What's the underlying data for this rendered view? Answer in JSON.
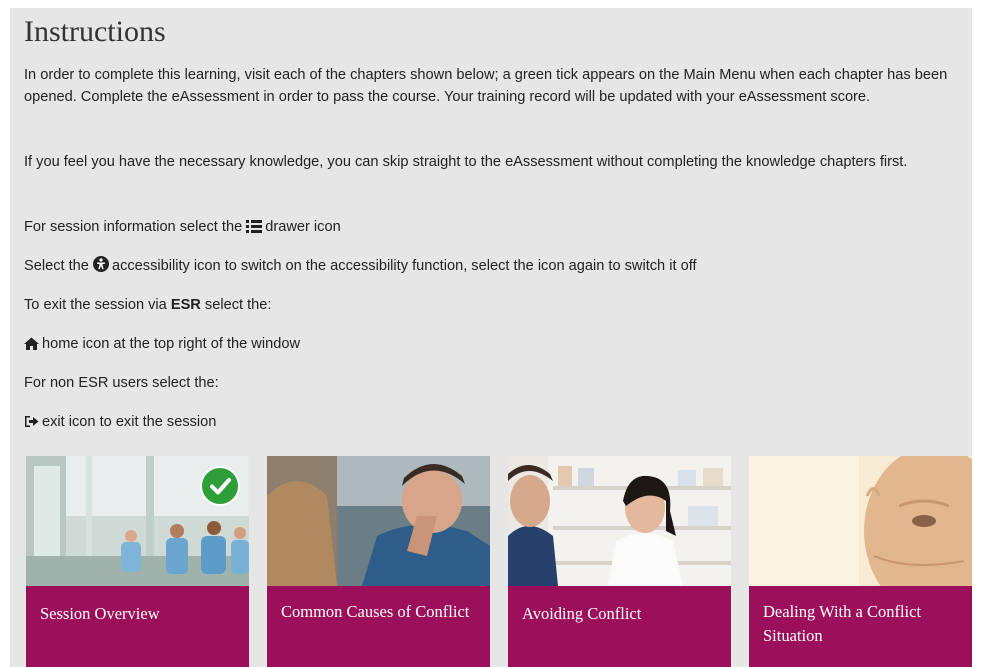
{
  "title": "Instructions",
  "paragraphs": {
    "p1": "In order to complete this learning, visit each of the chapters shown below; a green tick appears on the Main Menu when each chapter has been opened. Complete the eAssessment in order to pass the course. Your training record will be updated with your eAssessment score.",
    "p2": "If you feel you have the necessary knowledge, you can skip straight to the eAssessment without completing the knowledge chapters first."
  },
  "lines": {
    "drawer_pre": "For session information select the",
    "drawer_post": "drawer icon",
    "access_pre": "Select the",
    "access_post": "accessibility icon to switch on the accessibility function, select the icon again to switch it off",
    "esr_pre": "To exit the session via",
    "esr_bold": "ESR",
    "esr_post": "select the:",
    "home": "home icon at the top right of the window",
    "nonesr": "For non ESR users select the:",
    "exit": "exit icon to exit the session"
  },
  "icons": {
    "drawer": "list-icon",
    "accessibility": "accessibility-icon",
    "home": "home-icon",
    "exit": "exit-icon",
    "completed": "check-icon"
  },
  "chapters": [
    {
      "label": "Session Overview",
      "completed": true
    },
    {
      "label": "Common Causes of Conflict",
      "completed": false
    },
    {
      "label": "Avoiding Conflict",
      "completed": false
    },
    {
      "label": "Dealing With a Conflict Situation",
      "completed": false
    }
  ],
  "colors": {
    "card_bar": "#9c0f5a",
    "tick": "#2e9e38",
    "panel": "#e6e6e6"
  }
}
